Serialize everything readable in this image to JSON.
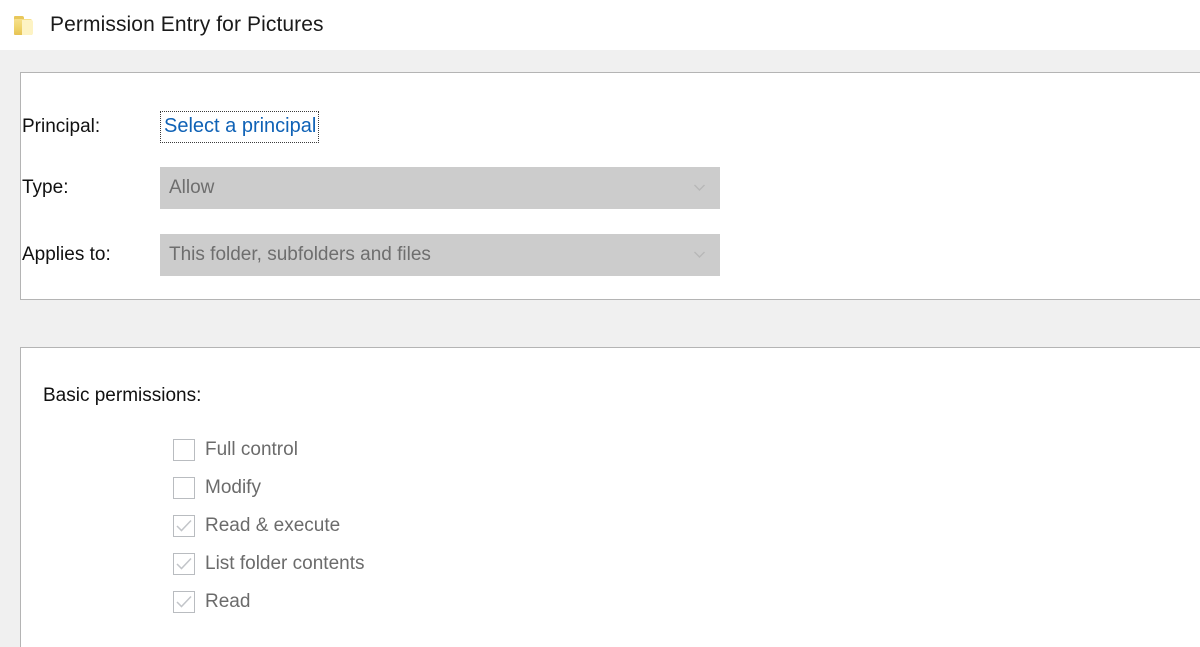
{
  "window": {
    "title": "Permission Entry for Pictures",
    "icon": "folder-icon"
  },
  "principal_panel": {
    "principal": {
      "label": "Principal:",
      "link_text": "Select a principal"
    },
    "type": {
      "label": "Type:",
      "value": "Allow",
      "chevron": "chevron-down-icon"
    },
    "applies_to": {
      "label": "Applies to:",
      "value": "This folder, subfolders and files",
      "chevron": "chevron-down-icon"
    }
  },
  "permissions_panel": {
    "heading": "Basic permissions:",
    "items": [
      {
        "label": "Full control",
        "checked": false
      },
      {
        "label": "Modify",
        "checked": false
      },
      {
        "label": "Read & execute",
        "checked": true
      },
      {
        "label": "List folder contents",
        "checked": true
      },
      {
        "label": "Read",
        "checked": true
      }
    ]
  },
  "colors": {
    "title_text": "#1a1a1a",
    "link": "#0f62b6",
    "combo_background": "#cccccc",
    "combo_text": "#6e6e6e",
    "panel_border": "#b4b4b4",
    "page_background": "#f0f0f0",
    "checkbox_border": "#b9bcc0",
    "perm_label": "#6b6b6b"
  }
}
